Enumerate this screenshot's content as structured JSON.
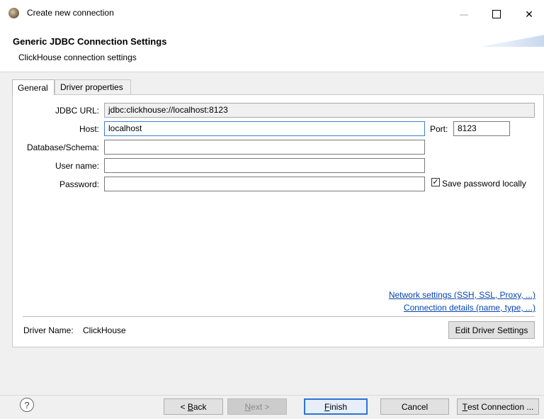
{
  "window": {
    "title": "Create new connection",
    "minimize_glyph": "—",
    "close_glyph": "✕"
  },
  "header": {
    "title": "Generic JDBC Connection Settings",
    "subtitle": "ClickHouse connection settings"
  },
  "tabs": [
    {
      "label": "General",
      "active": true
    },
    {
      "label": "Driver properties",
      "active": false
    }
  ],
  "form": {
    "jdbc_url_label": "JDBC URL:",
    "jdbc_url_value": "jdbc:clickhouse://localhost:8123",
    "host_label": "Host:",
    "host_value": "localhost",
    "port_label": "Port:",
    "port_value": "8123",
    "database_label": "Database/Schema:",
    "database_value": "",
    "username_label": "User name:",
    "username_value": "",
    "password_label": "Password:",
    "password_value": "",
    "save_password_label": "Save password locally",
    "save_password_checked": "✓"
  },
  "links": {
    "network": "Network settings (SSH, SSL, Proxy, ...)",
    "details": "Connection details (name, type, ...)"
  },
  "driver": {
    "name_label": "Driver Name:",
    "name_value": "ClickHouse",
    "edit_button": "Edit Driver Settings"
  },
  "footer": {
    "help_glyph": "?",
    "back_prefix": "< ",
    "back_mnemonic": "B",
    "back_rest": "ack",
    "next_mnemonic": "N",
    "next_rest": "ext >",
    "finish_mnemonic": "F",
    "finish_rest": "inish",
    "cancel": "Cancel",
    "test_mnemonic": "T",
    "test_rest": "est Connection ..."
  }
}
